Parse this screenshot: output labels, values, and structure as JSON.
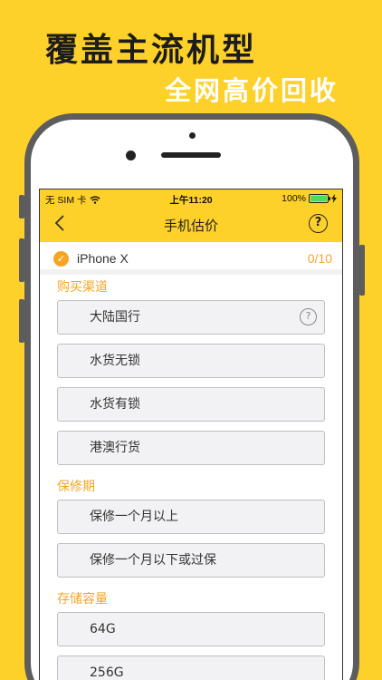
{
  "promo": {
    "line1": "覆盖主流机型",
    "line2": "全网高价回收"
  },
  "status_bar": {
    "carrier": "无 SIM 卡",
    "time": "上午11:20",
    "battery": "100%"
  },
  "nav": {
    "back_icon": "‹",
    "title": "手机估价",
    "help_icon": "?"
  },
  "model": {
    "name": "iPhone X",
    "progress": "0/10",
    "check_icon": "✓"
  },
  "sections": {
    "purchase_channel": {
      "title": "购买渠道",
      "options": [
        "大陆国行",
        "水货无锁",
        "水货有锁",
        "港澳行货"
      ]
    },
    "warranty": {
      "title": "保修期",
      "options": [
        "保修一个月以上",
        "保修一个月以下或过保"
      ]
    },
    "storage": {
      "title": "存储容量",
      "options": [
        "64G",
        "256G"
      ]
    }
  },
  "colors": {
    "background": "#FDD02A",
    "accent": "#F5A524",
    "frame": "#5d5d5d"
  }
}
